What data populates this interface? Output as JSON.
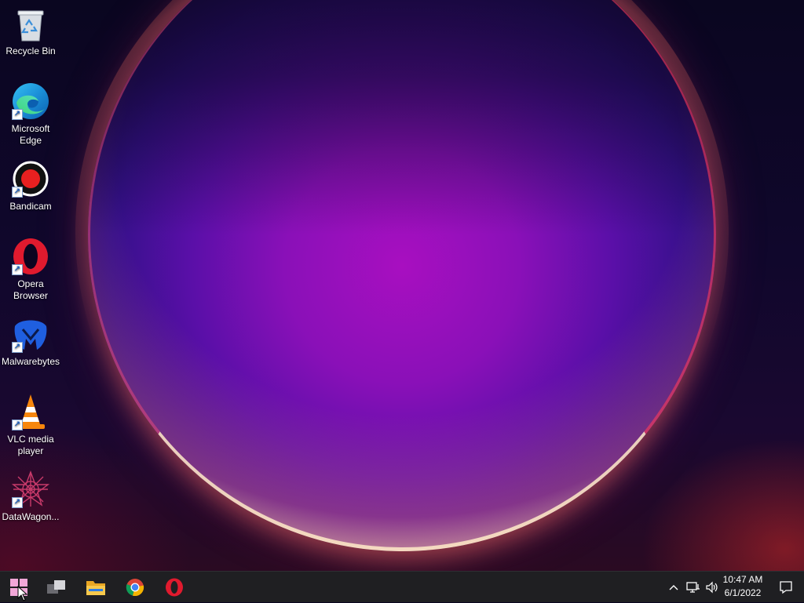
{
  "desktop": {
    "icons": [
      {
        "label": "Recycle Bin",
        "icon": "recycle-bin-icon"
      },
      {
        "label": "Microsoft Edge",
        "icon": "edge-icon"
      },
      {
        "label": "Bandicam",
        "icon": "bandicam-icon"
      },
      {
        "label": "Opera Browser",
        "icon": "opera-icon"
      },
      {
        "label": "Malwarebytes",
        "icon": "malwarebytes-icon"
      },
      {
        "label": "VLC media player",
        "icon": "vlc-icon"
      },
      {
        "label": "DataWagon...",
        "icon": "datawagon-icon"
      }
    ]
  },
  "taskbar": {
    "pinned": [
      {
        "name": "Start",
        "icon": "windows-start-icon"
      },
      {
        "name": "Task View",
        "icon": "task-view-icon"
      },
      {
        "name": "File Explorer",
        "icon": "file-explorer-icon"
      },
      {
        "name": "Google Chrome",
        "icon": "chrome-icon"
      },
      {
        "name": "Opera",
        "icon": "opera-icon"
      }
    ],
    "tray": {
      "chevron": "^",
      "time": "10:47 AM",
      "date": "6/1/2022"
    }
  },
  "colors": {
    "taskbar": "#1f1f22",
    "orb_core": "#a80fc0",
    "rim": "#ffe6c8"
  }
}
